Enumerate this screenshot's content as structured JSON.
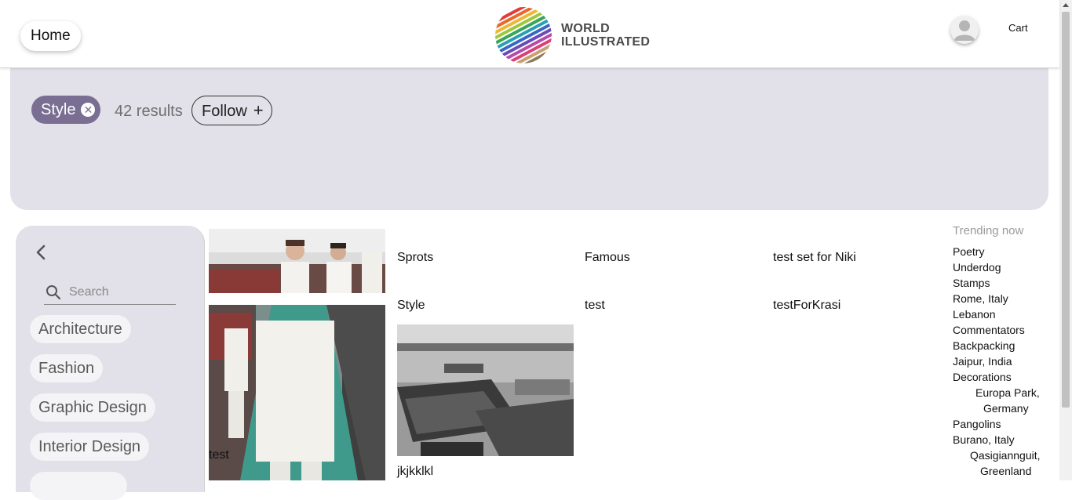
{
  "header": {
    "home_label": "Home",
    "logo_line1": "WORLD",
    "logo_line2": "ILLUSTRATED",
    "cart_label": "Cart"
  },
  "banner": {
    "tag_label": "Style",
    "results_text": "42 results",
    "follow_label": "Follow",
    "follow_plus": "+",
    "close_glyph": "✕"
  },
  "sidebar": {
    "search_placeholder": "Search",
    "categories": [
      "Architecture",
      "Fashion",
      "Graphic Design",
      "Interior Design"
    ]
  },
  "grid": {
    "items": [
      {
        "label": "test"
      },
      {
        "label": "Sprots"
      },
      {
        "label": "Famous"
      },
      {
        "label": "test set for Niki"
      },
      {
        "label": "Style"
      },
      {
        "label": "test"
      },
      {
        "label": "testForKrasi"
      },
      {
        "label": "jkjkklkl"
      }
    ]
  },
  "trending": {
    "title": "Trending now",
    "items": [
      "Poetry",
      "Underdog",
      "Stamps",
      "Rome, Italy",
      "Lebanon",
      "Commentators",
      "Backpacking",
      "Jaipur, India",
      "Decorations",
      "Europa Park,",
      "Germany",
      "Pangolins",
      "Burano, Italy",
      "Qasigiannguit,",
      "Greenland"
    ]
  },
  "colors": {
    "banner_bg": "#e2e0e8",
    "tag_bg": "#7a6e93",
    "chip_bg": "#f4f3f6"
  },
  "icons": {
    "close": "close-icon",
    "plus": "plus-icon",
    "back": "chevron-left-icon",
    "search": "search-icon",
    "avatar": "user-avatar-icon"
  }
}
